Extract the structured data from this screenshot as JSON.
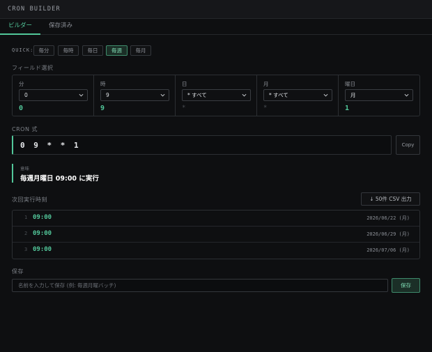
{
  "app": {
    "title": "CRON BUILDER"
  },
  "tabs": [
    {
      "label": "ビルダー",
      "active": true
    },
    {
      "label": "保存済み",
      "active": false
    }
  ],
  "quick": {
    "label": "QUICK:",
    "presets": [
      {
        "label": "毎分",
        "active": false
      },
      {
        "label": "毎時",
        "active": false
      },
      {
        "label": "毎日",
        "active": false
      },
      {
        "label": "毎週",
        "active": true
      },
      {
        "label": "毎月",
        "active": false
      }
    ]
  },
  "fields_section": {
    "label": "フィールド選択"
  },
  "fields": [
    {
      "name": "分",
      "selected": "0",
      "value": "0"
    },
    {
      "name": "時",
      "selected": "9",
      "value": "9"
    },
    {
      "name": "日",
      "selected": "* すべて",
      "value": "*"
    },
    {
      "name": "月",
      "selected": "* すべて",
      "value": "*"
    },
    {
      "name": "曜日",
      "selected": "月",
      "value": "1"
    }
  ],
  "cron": {
    "label": "CRON 式",
    "expression": "0 9 * * 1",
    "copy_label": "Copy"
  },
  "meaning": {
    "label": "意味",
    "text": "毎週月曜日 09:00 に実行"
  },
  "next_runs": {
    "label": "次回実行時刻",
    "csv_label": "↓ 50件 CSV 出力",
    "rows": [
      {
        "index": "1",
        "time": "09:00",
        "date": "2026/06/22 (月)"
      },
      {
        "index": "2",
        "time": "09:00",
        "date": "2026/06/29 (月)"
      },
      {
        "index": "3",
        "time": "09:00",
        "date": "2026/07/06 (月)"
      }
    ]
  },
  "save": {
    "label": "保存",
    "placeholder": "名前を入力して保存 (例: 毎週月曜バッチ)",
    "button_label": "保存"
  },
  "colors": {
    "accent": "#52c79a",
    "background": "#0e0f11",
    "panel_border": "#2c2f33"
  }
}
